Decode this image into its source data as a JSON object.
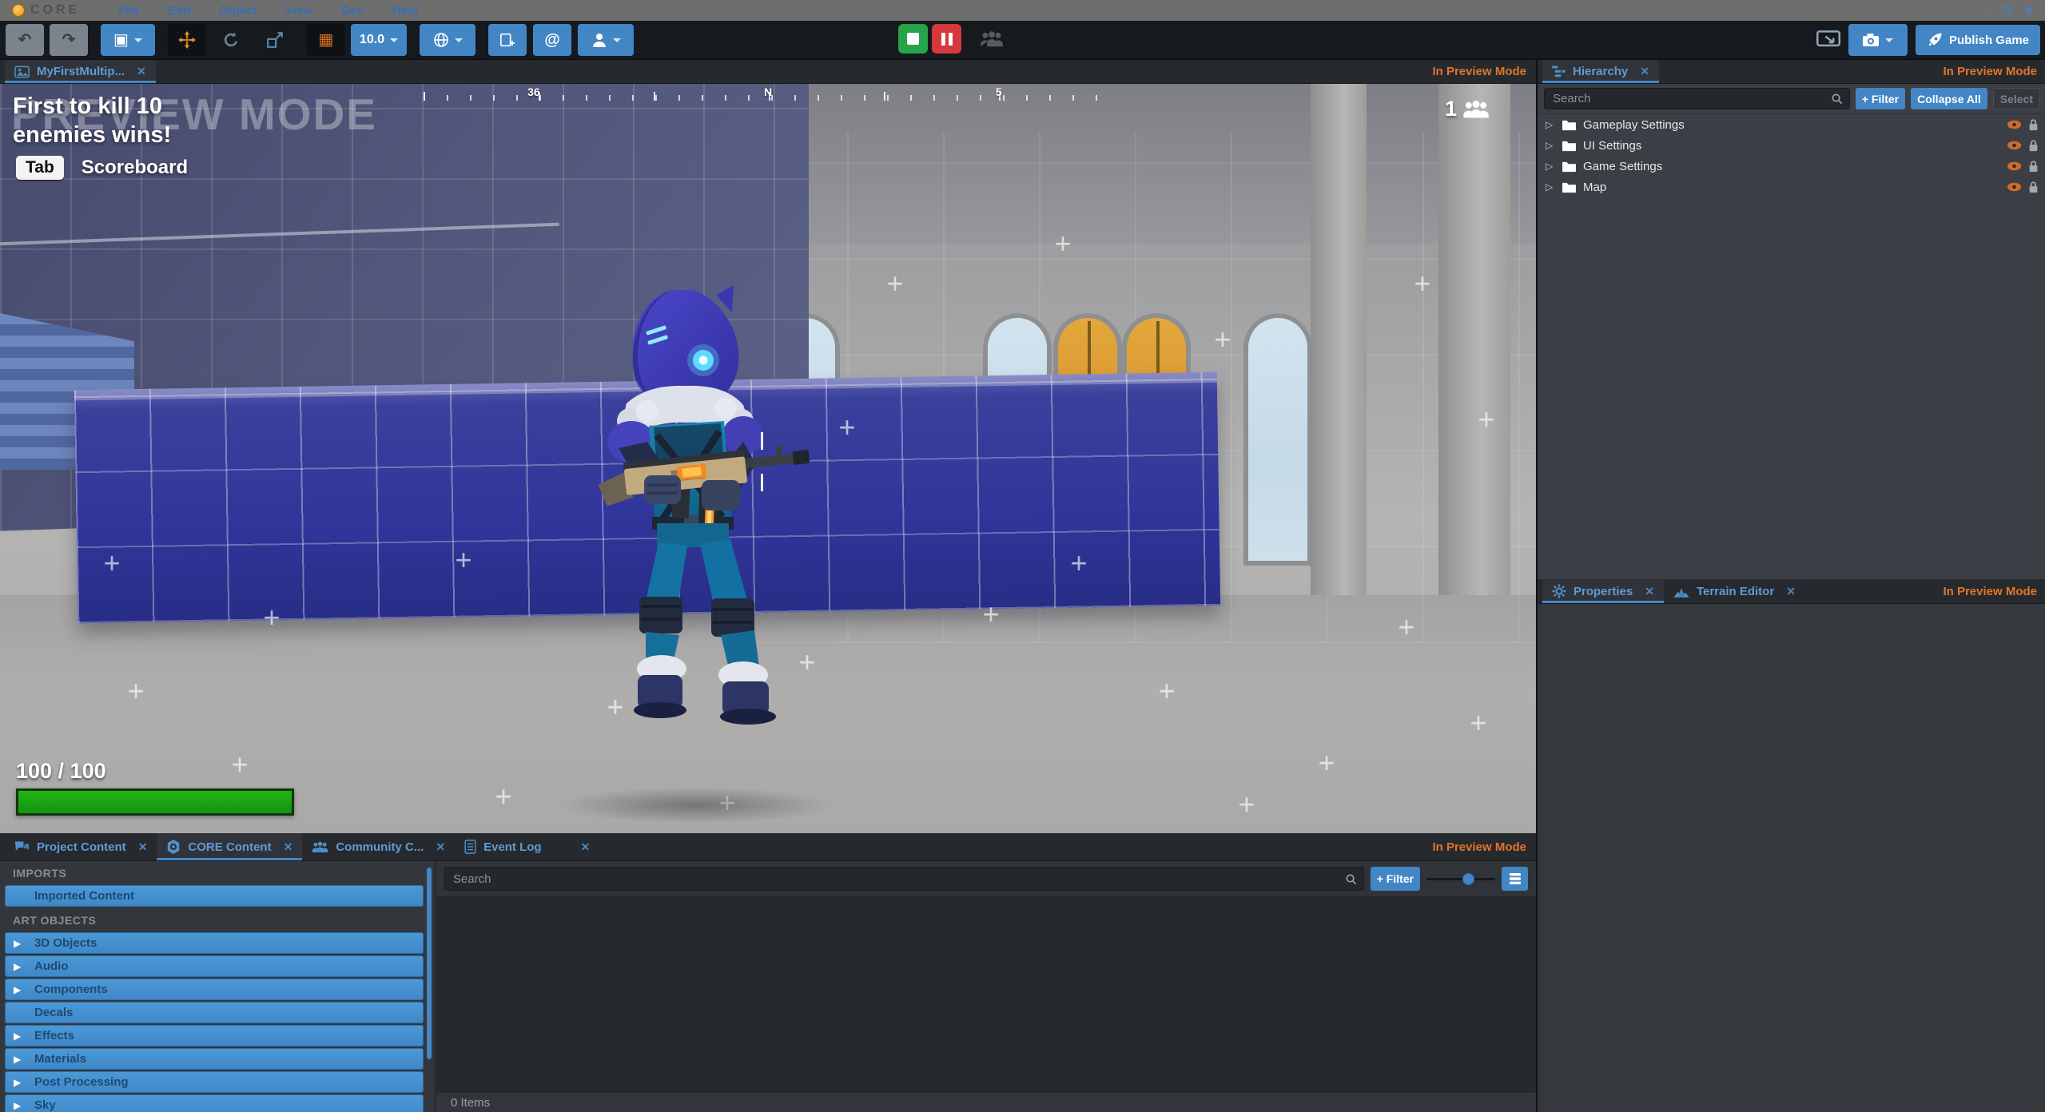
{
  "ui": {
    "preview_mode": "In Preview Mode",
    "close_icon": "✕",
    "expander_icon": "▷"
  },
  "colors": {
    "accent_blue": "#4286c6",
    "accent_orange": "#e0762a",
    "menu_blue": "#3a6db0",
    "stop_green": "#27a349",
    "pause_red": "#d6383d",
    "health_green": "#17a015",
    "category_row_blue": "#4492d0",
    "blue_wall": "#2f3494"
  },
  "menubar": {
    "logo_text": "CORE",
    "items": [
      "File",
      "Edit",
      "Object",
      "View",
      "Dev",
      "Help"
    ],
    "window_controls": {
      "minimize": "–",
      "restore": "❐",
      "close": "✕"
    }
  },
  "toolbar": {
    "undo_icon": "↶",
    "redo_icon": "↷",
    "select_icon": "▣",
    "grid_icon": "▦",
    "grid_size": "10.0",
    "at_icon": "@",
    "publish_label": "Publish Game"
  },
  "viewport": {
    "tab_label": "MyFirstMultip...",
    "hud": {
      "watermark": "PREVIEW MODE",
      "objective_line1": "First to kill 10",
      "objective_line2": "enemies wins!",
      "key_hint": "Tab",
      "key_action": "Scoreboard",
      "player_count": "1",
      "health_text": "100 / 100",
      "health_percent": 100,
      "compass_labels": [
        "36",
        "N",
        "5"
      ]
    }
  },
  "hierarchy": {
    "tab_label": "Hierarchy",
    "search_placeholder": "Search",
    "filter_button": "+ Filter",
    "collapse_button": "Collapse All",
    "select_button": "Select",
    "items": [
      {
        "label": "Gameplay Settings"
      },
      {
        "label": "UI Settings"
      },
      {
        "label": "Game Settings"
      },
      {
        "label": "Map"
      }
    ]
  },
  "properties_panel": {
    "tabs": [
      {
        "label": "Properties"
      },
      {
        "label": "Terrain Editor"
      }
    ]
  },
  "content_panel": {
    "tabs": [
      {
        "label": "Project Content"
      },
      {
        "label": "CORE Content"
      },
      {
        "label": "Community C..."
      },
      {
        "label": "Event Log"
      }
    ],
    "sections": [
      {
        "header": "IMPORTS",
        "items": [
          {
            "label": "Imported Content",
            "arrow": ""
          }
        ]
      },
      {
        "header": "ART OBJECTS",
        "items": [
          {
            "label": "3D Objects",
            "arrow": "▶"
          },
          {
            "label": "Audio",
            "arrow": "▶"
          },
          {
            "label": "Components",
            "arrow": "▶"
          },
          {
            "label": "Decals",
            "arrow": ""
          },
          {
            "label": "Effects",
            "arrow": "▶"
          },
          {
            "label": "Materials",
            "arrow": "▶"
          },
          {
            "label": "Post Processing",
            "arrow": "▶"
          },
          {
            "label": "Sky",
            "arrow": "▶"
          }
        ]
      }
    ],
    "search_placeholder": "Search",
    "filter_button": "+ Filter",
    "status": "0 Items"
  }
}
